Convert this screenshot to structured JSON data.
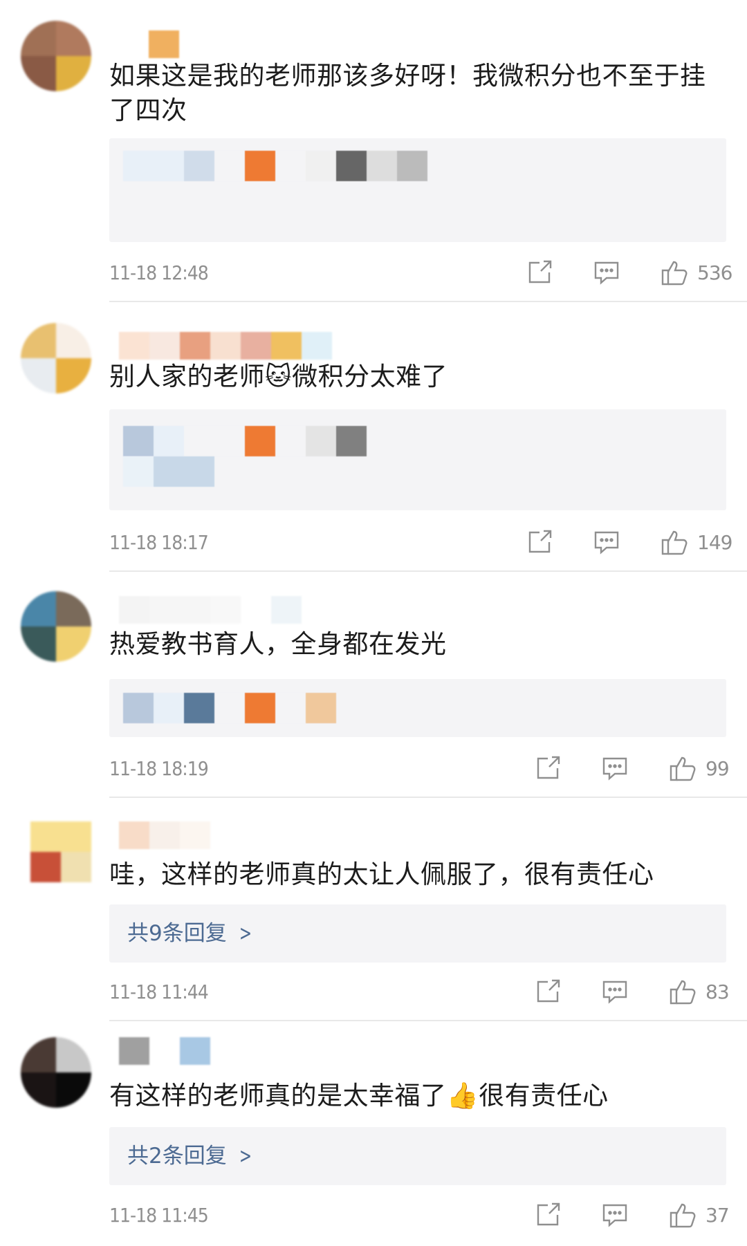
{
  "comments": [
    {
      "text": "如果这是我的老师那该多好呀！我微积分也不至于挂了四次",
      "time": "11-18 12:48",
      "likes": "536",
      "reply_summary": null
    },
    {
      "text": "别人家的老师🐱微积分太难了",
      "time": "11-18 18:17",
      "likes": "149",
      "reply_summary": null
    },
    {
      "text": "热爱教书育人，全身都在发光",
      "time": "11-18 18:19",
      "likes": "99",
      "reply_summary": null
    },
    {
      "text": "哇，这样的老师真的太让人佩服了，很有责任心",
      "time": "11-18 11:44",
      "likes": "83",
      "reply_summary": "共9条回复"
    },
    {
      "text": "有这样的老师真的是太幸福了👍很有责任心",
      "time": "11-18 11:45",
      "likes": "37",
      "reply_summary": "共2条回复"
    }
  ],
  "icons": {
    "share": "share-icon",
    "comment": "comment-icon",
    "like": "thumbs-up-icon",
    "reply_chevron": "chevron-right-icon"
  },
  "colors": {
    "link": "#4c6a92",
    "meta": "#8f8f8f",
    "reply_bg": "#f4f4f6"
  }
}
